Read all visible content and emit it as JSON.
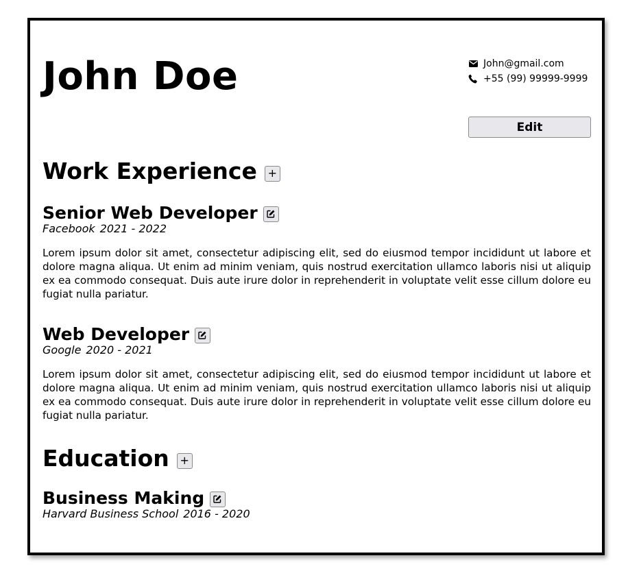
{
  "header": {
    "name": "John Doe",
    "email": "John@gmail.com",
    "phone": "+55 (99) 99999-9999",
    "edit_label": "Edit",
    "email_icon": "envelope-icon",
    "phone_icon": "phone-icon"
  },
  "work": {
    "title": "Work Experience",
    "add_label": "+",
    "jobs": [
      {
        "title": "Senior Web Developer",
        "company": "Facebook",
        "period": "2021 - 2022",
        "description": "Lorem ipsum dolor sit amet, consectetur adipiscing elit, sed do eiusmod tempor incididunt ut la­bore et dolore magna aliqua. Ut enim ad minim veniam, quis nostrud exercitation ullamco laboris nisi ut aliquip ex ea commodo consequat. Duis aute irure dolor in reprehenderit in voluptate velit esse cillum dolore eu fugiat nulla pariatur."
      },
      {
        "title": "Web Developer",
        "company": "Google",
        "period": "2020 - 2021",
        "description": "Lorem ipsum dolor sit amet, consectetur adipiscing elit, sed do eiusmod tempor incididunt ut la­bore et dolore magna aliqua. Ut enim ad minim veniam, quis nostrud exercitation ullamco laboris nisi ut aliquip ex ea commodo consequat. Duis aute irure dolor in reprehenderit in voluptate velit esse cillum dolore eu fugiat nulla pariatur."
      }
    ]
  },
  "education": {
    "title": "Education",
    "add_label": "+",
    "items": [
      {
        "title": "Business Making",
        "school": "Harvard Business School",
        "period": "2016 - 2020"
      }
    ]
  },
  "colors": {
    "border": "#000000",
    "button_bg": "#e8e8ec",
    "button_border": "#8a8a8a"
  }
}
